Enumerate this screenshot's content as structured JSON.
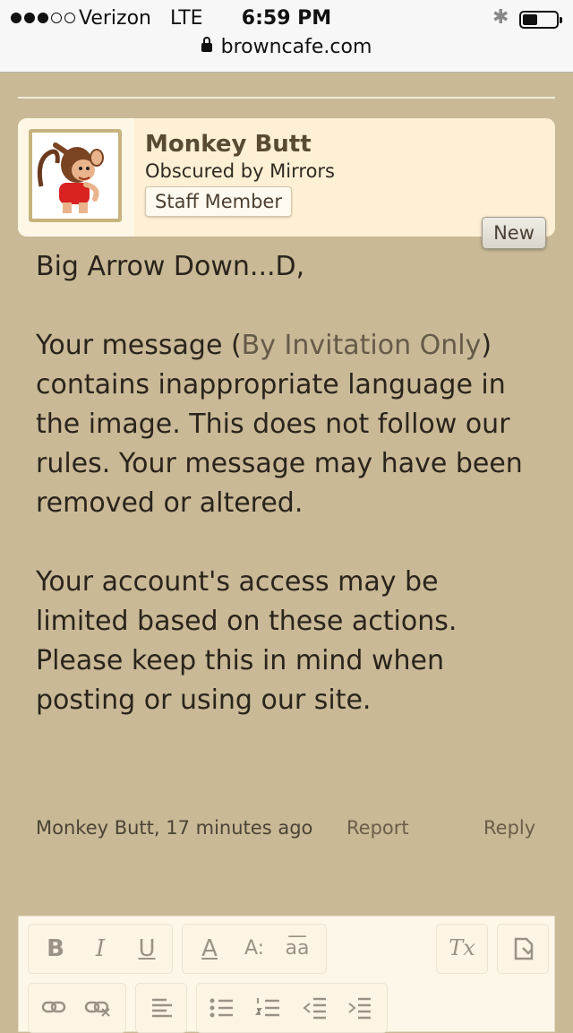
{
  "status_bar": {
    "carrier": "Verizon",
    "network": "LTE",
    "time": "6:59 PM",
    "bluetooth_icon": "bluetooth-icon",
    "battery_icon": "battery-icon"
  },
  "url_bar": {
    "lock_icon": "lock-icon",
    "domain": "browncafe.com"
  },
  "author": {
    "name": "Monkey Butt",
    "title": "Obscured by Mirrors",
    "badge": "Staff Member"
  },
  "new_label": "New",
  "message": {
    "greeting": "Big Arrow Down...D,",
    "p1_before": "Your message (",
    "p1_link": "By Invitation Only",
    "p1_after": ") contains inappropriate language in the image. This does not follow our rules. Your message may have been removed or altered.",
    "p2": "Your account's access may be limited based on these actions. Please keep this in mind when posting or using our site."
  },
  "post_meta": {
    "author_time": "Monkey Butt, 17 minutes ago",
    "report": "Report",
    "reply": "Reply"
  },
  "editor_toolbar": {
    "bold": "B",
    "italic": "I",
    "underline": "U",
    "font_color": "A",
    "font_size": "A:",
    "font_family": "a͞a",
    "remove_format": "Tx"
  },
  "colors": {
    "page_bg": "#c9b996",
    "card_bg": "#fdf0d4",
    "link": "#665a48"
  }
}
